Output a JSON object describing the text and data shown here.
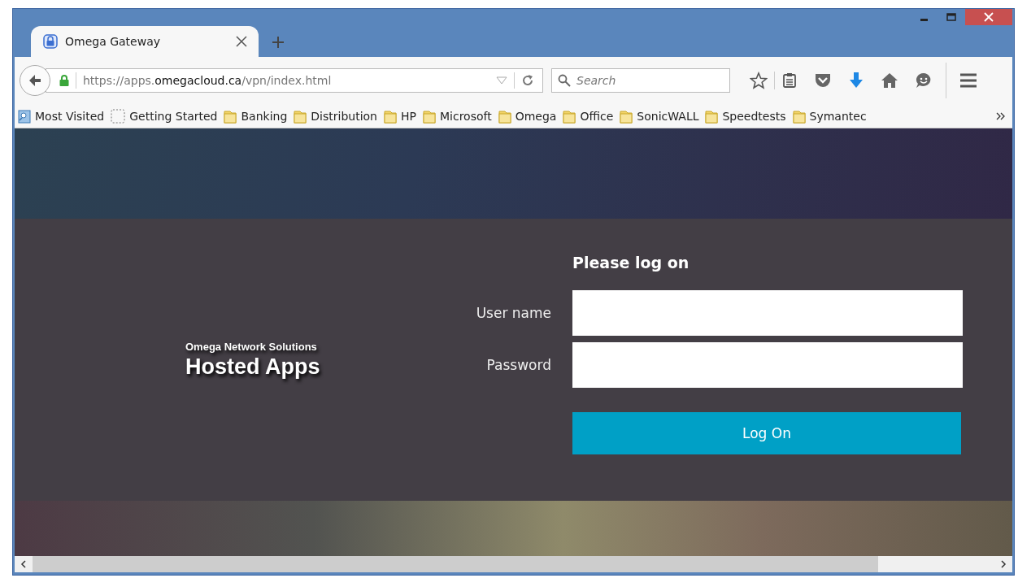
{
  "tab": {
    "title": "Omega Gateway",
    "selected": true
  },
  "address": {
    "prefix": "https://apps.",
    "domain": "omegacloud.ca",
    "path": "/vpn/index.html"
  },
  "search": {
    "placeholder": "Search"
  },
  "bookmarks": [
    {
      "label": "Most Visited",
      "kind": "smart"
    },
    {
      "label": "Getting Started",
      "kind": "page"
    },
    {
      "label": "Banking",
      "kind": "folder"
    },
    {
      "label": "Distribution",
      "kind": "folder"
    },
    {
      "label": "HP",
      "kind": "folder"
    },
    {
      "label": "Microsoft",
      "kind": "folder"
    },
    {
      "label": "Omega",
      "kind": "folder"
    },
    {
      "label": "Office",
      "kind": "folder"
    },
    {
      "label": "SonicWALL",
      "kind": "folder"
    },
    {
      "label": "Speedtests",
      "kind": "folder"
    },
    {
      "label": "Symantec",
      "kind": "folder"
    }
  ],
  "brand": {
    "company": "Omega Network Solutions",
    "product": "Hosted Apps"
  },
  "login": {
    "heading": "Please log on",
    "fields": [
      {
        "label": "User name"
      },
      {
        "label": "Password"
      }
    ],
    "button": "Log On"
  }
}
